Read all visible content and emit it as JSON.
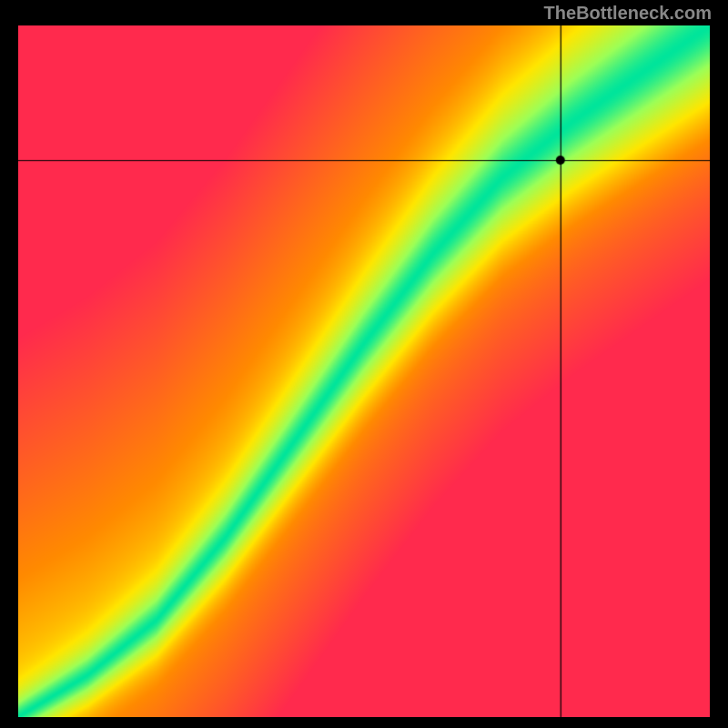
{
  "watermark": "TheBottleneck.com",
  "chart_data": {
    "type": "heatmap",
    "title": "",
    "xlabel": "",
    "ylabel": "",
    "xlim": [
      0,
      1
    ],
    "ylim": [
      0,
      1
    ],
    "marker": {
      "x": 0.785,
      "y": 0.805
    },
    "crosshair": {
      "x": 0.785,
      "y": 0.805
    },
    "colorscale": [
      {
        "value": 0.0,
        "color": "#ff2a4d"
      },
      {
        "value": 0.35,
        "color": "#ff8a00"
      },
      {
        "value": 0.55,
        "color": "#ffe600"
      },
      {
        "value": 0.8,
        "color": "#9cff57"
      },
      {
        "value": 1.0,
        "color": "#00e59b"
      }
    ],
    "ridge": [
      {
        "x": 0.0,
        "y": 0.0
      },
      {
        "x": 0.1,
        "y": 0.06
      },
      {
        "x": 0.2,
        "y": 0.14
      },
      {
        "x": 0.3,
        "y": 0.26
      },
      {
        "x": 0.4,
        "y": 0.4
      },
      {
        "x": 0.5,
        "y": 0.54
      },
      {
        "x": 0.6,
        "y": 0.67
      },
      {
        "x": 0.7,
        "y": 0.78
      },
      {
        "x": 0.8,
        "y": 0.86
      },
      {
        "x": 0.9,
        "y": 0.93
      },
      {
        "x": 1.0,
        "y": 1.0
      }
    ],
    "ridge_width": 0.06,
    "grid": false,
    "legend": false
  }
}
